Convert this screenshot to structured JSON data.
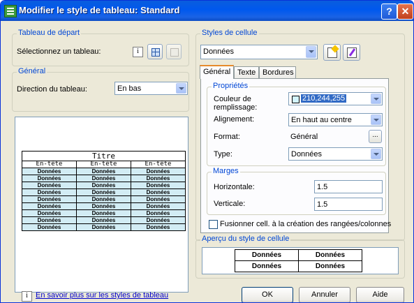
{
  "title": "Modifier le style de tableau: Standard",
  "titlebar": {
    "help": "?",
    "close": "✕"
  },
  "start_table": {
    "legend": "Tableau de départ",
    "select_label": "Sélectionnez un tableau:"
  },
  "general": {
    "legend": "Général",
    "direction_label": "Direction du tableau:",
    "direction_value": "En bas"
  },
  "preview": {
    "title": "Titre",
    "headers": [
      "En-tête",
      "En-tête",
      "En-tête"
    ],
    "data_cell": "Données",
    "rows": 9
  },
  "cell_styles": {
    "legend": "Styles de cellule",
    "selected": "Données"
  },
  "tabs": [
    "Général",
    "Texte",
    "Bordures"
  ],
  "properties": {
    "legend": "Propriétés",
    "fill_label_1": "Couleur de",
    "fill_label_2": "remplissage:",
    "fill_value": "210,244,255",
    "fill_color": "#d2f4ff",
    "alignment_label": "Alignement:",
    "alignment_value": "En haut au centre",
    "format_label": "Format:",
    "format_value": "Général",
    "format_btn": "...",
    "type_label": "Type:",
    "type_value": "Données"
  },
  "margins": {
    "legend": "Marges",
    "horizontal_label": "Horizontale:",
    "horizontal_value": "1.5",
    "vertical_label": "Verticale:",
    "vertical_value": "1.5"
  },
  "merge_label": "Fusionner cell. à la création des rangées/colonnes",
  "cell_preview": {
    "legend": "Aperçu du style de cellule",
    "cells": [
      "Données",
      "Données",
      "Données",
      "Données"
    ]
  },
  "footer": {
    "link": "En savoir plus sur les styles de tableau",
    "ok": "OK",
    "cancel": "Annuler",
    "help": "Aide"
  }
}
